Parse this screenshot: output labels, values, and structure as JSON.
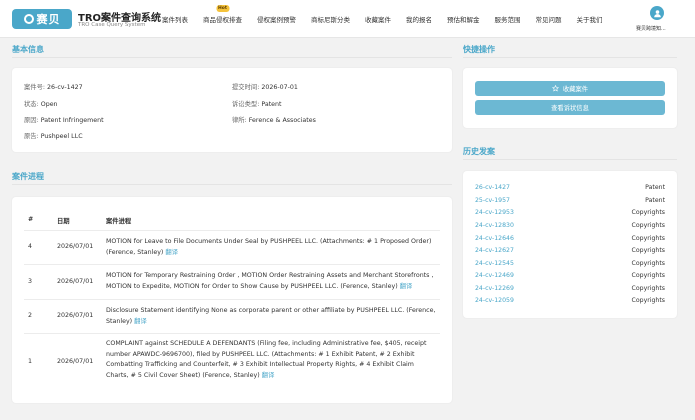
{
  "header": {
    "logo_text": "赛贝",
    "brand_title": "TRO案件查询系统",
    "brand_subtitle": "TRO Case Query System",
    "nav": [
      {
        "label": "案件列表"
      },
      {
        "label": "商品侵权排查",
        "badge": "Hot"
      },
      {
        "label": "侵权案例预警"
      },
      {
        "label": "商标尼斯分类"
      },
      {
        "label": "收藏案件"
      },
      {
        "label": "我的报名"
      },
      {
        "label": "预估和解金"
      },
      {
        "label": "服务范围"
      },
      {
        "label": "常见问题"
      },
      {
        "label": "关于我们"
      }
    ],
    "user_name": "赛贝跨境知..."
  },
  "basic_info": {
    "title": "基本信息",
    "case_no_label": "案件号:",
    "case_no": "26-cv-1427",
    "filed_label": "提交时间:",
    "filed": "2026-07-01",
    "status_label": "状态:",
    "status": "Open",
    "type_label": "诉讼类型:",
    "type": "Patent",
    "cause_label": "原因:",
    "cause": "Patent Infringement",
    "firm_label": "律所:",
    "firm": "Ference & Associates",
    "plaintiff_label": "原告:",
    "plaintiff": "Pushpeel LLC"
  },
  "progress": {
    "title": "案件进程",
    "headers": {
      "no": "#",
      "date": "日期",
      "text": "案件进程"
    },
    "translate_label": "翻译",
    "rows": [
      {
        "no": "4",
        "date": "2026/07/01",
        "text": "MOTION for Leave to File Documents Under Seal by PUSHPEEL LLC. (Attachments: # 1 Proposed Order) (Ference, Stanley)"
      },
      {
        "no": "3",
        "date": "2026/07/01",
        "text": "MOTION for Temporary Restraining Order , MOTION Order Restraining Assets and Merchant Storefronts , MOTION to Expedite, MOTION for Order to Show Cause by PUSHPEEL LLC. (Ference, Stanley)"
      },
      {
        "no": "2",
        "date": "2026/07/01",
        "text": "Disclosure Statement identifying None as corporate parent or other affiliate by PUSHPEEL LLC. (Ference, Stanley)"
      },
      {
        "no": "1",
        "date": "2026/07/01",
        "text": "COMPLAINT against SCHEDULE A DEFENDANTS (Filing fee, including Administrative fee, $405, receipt number APAWDC-9696700), filed by PUSHPEEL LLC. (Attachments: # 1 Exhibit Patent, # 2 Exhibit Combatting Trafficking and Counterfeit, # 3 Exhibit Intellectual Property Rights, # 4 Exhibit Claim Charts, # 5 Civil Cover Sheet) (Ference, Stanley)"
      }
    ]
  },
  "quick_actions": {
    "title": "快捷操作",
    "favorite_label": "收藏案件",
    "view_label": "查看诉状信息"
  },
  "history": {
    "title": "历史发案",
    "items": [
      {
        "case_no": "26-cv-1427",
        "type": "Patent"
      },
      {
        "case_no": "25-cv-1957",
        "type": "Patent"
      },
      {
        "case_no": "24-cv-12953",
        "type": "Copyrights"
      },
      {
        "case_no": "24-cv-12830",
        "type": "Copyrights"
      },
      {
        "case_no": "24-cv-12646",
        "type": "Copyrights"
      },
      {
        "case_no": "24-cv-12627",
        "type": "Copyrights"
      },
      {
        "case_no": "24-cv-12545",
        "type": "Copyrights"
      },
      {
        "case_no": "24-cv-12469",
        "type": "Copyrights"
      },
      {
        "case_no": "24-cv-12269",
        "type": "Copyrights"
      },
      {
        "case_no": "24-cv-12059",
        "type": "Copyrights"
      }
    ]
  },
  "colors": {
    "accent": "#4aa7c9",
    "button": "#6cb8d3",
    "badge": "#f5c33b",
    "background": "#f2f2f2"
  }
}
